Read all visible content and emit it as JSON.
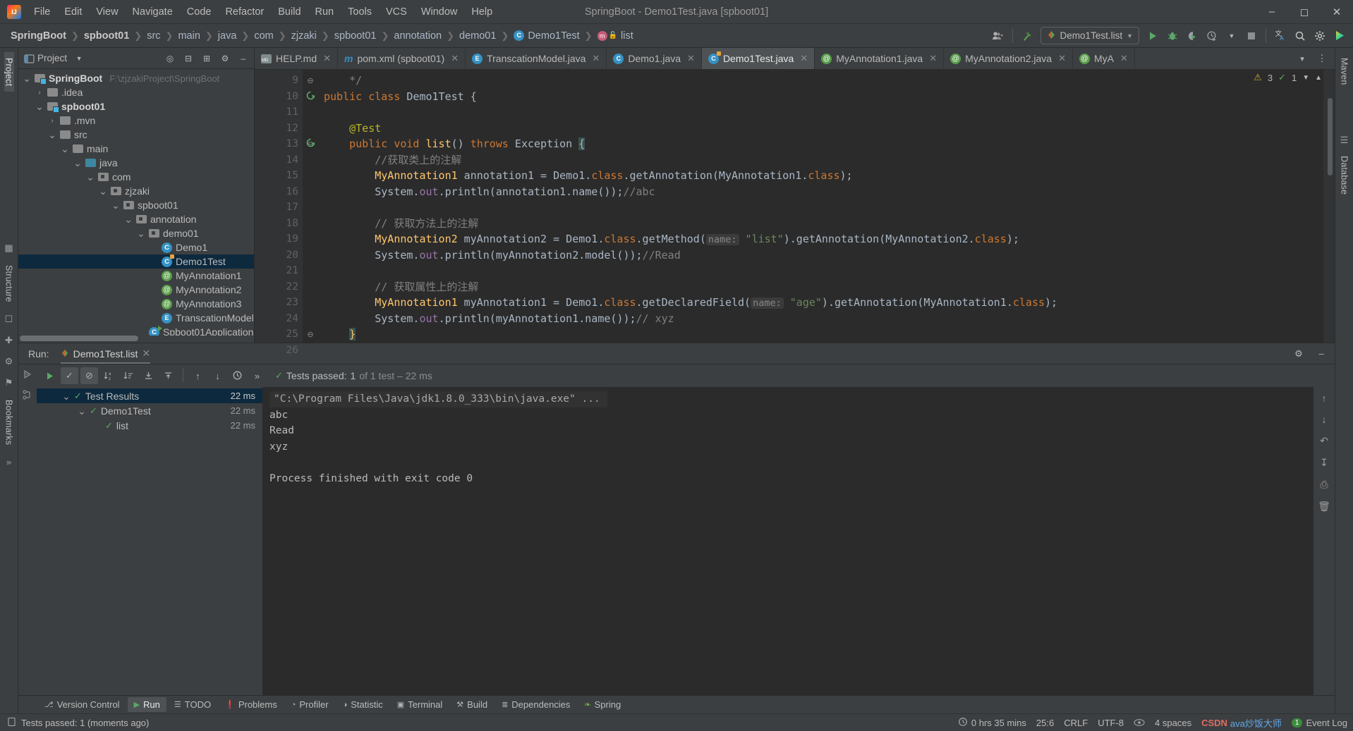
{
  "window": {
    "title": "SpringBoot - Demo1Test.java [spboot01]",
    "logo_icon": "intellij-idea-logo",
    "minimize_icon": "minimize-icon",
    "maximize_icon": "maximize-icon",
    "close_icon": "close-icon"
  },
  "menubar": {
    "items": [
      "File",
      "Edit",
      "View",
      "Navigate",
      "Code",
      "Refactor",
      "Build",
      "Run",
      "Tools",
      "VCS",
      "Window",
      "Help"
    ]
  },
  "navbar": {
    "crumbs": [
      {
        "label": "SpringBoot",
        "bold": true,
        "icon": ""
      },
      {
        "label": "spboot01",
        "bold": true,
        "icon": ""
      },
      {
        "label": "src",
        "bold": false,
        "icon": ""
      },
      {
        "label": "main",
        "bold": false,
        "icon": ""
      },
      {
        "label": "java",
        "bold": false,
        "icon": ""
      },
      {
        "label": "com",
        "bold": false,
        "icon": ""
      },
      {
        "label": "zjzaki",
        "bold": false,
        "icon": ""
      },
      {
        "label": "spboot01",
        "bold": false,
        "icon": ""
      },
      {
        "label": "annotation",
        "bold": false,
        "icon": ""
      },
      {
        "label": "demo01",
        "bold": false,
        "icon": ""
      },
      {
        "label": "Demo1Test",
        "bold": false,
        "icon": "class-icon"
      },
      {
        "label": "list",
        "bold": false,
        "icon": "method-icon"
      }
    ],
    "run_config": "Demo1Test.list",
    "run_config_icon": "junit-icon",
    "icons": [
      "user-icon",
      "hammer-build-icon",
      "run-icon",
      "debug-icon",
      "run-coverage-icon",
      "profile-icon",
      "stop-icon",
      "translate-icon",
      "search-icon",
      "settings-gear-icon",
      "idea-assistant-icon"
    ]
  },
  "project_panel": {
    "title": "Project",
    "header_icons": [
      "project-view-dropdown",
      "locate-file-icon",
      "expand-all-icon",
      "collapse-all-icon",
      "settings-gear-icon",
      "hide-icon"
    ],
    "tree": [
      {
        "label": "SpringBoot",
        "path": "F:\\zjzakiProject\\SpringBoot",
        "indent": 0,
        "chevron": "down",
        "icon": "module-folder-icon",
        "bold": true,
        "selected": false
      },
      {
        "label": ".idea",
        "path": "",
        "indent": 1,
        "chevron": "right",
        "icon": "folder-icon",
        "bold": false,
        "selected": false
      },
      {
        "label": "spboot01",
        "path": "",
        "indent": 1,
        "chevron": "down",
        "icon": "module-folder-icon",
        "bold": true,
        "selected": false
      },
      {
        "label": ".mvn",
        "path": "",
        "indent": 2,
        "chevron": "right",
        "icon": "folder-icon",
        "bold": false,
        "selected": false
      },
      {
        "label": "src",
        "path": "",
        "indent": 2,
        "chevron": "down",
        "icon": "folder-icon",
        "bold": false,
        "selected": false
      },
      {
        "label": "main",
        "path": "",
        "indent": 3,
        "chevron": "down",
        "icon": "folder-icon",
        "bold": false,
        "selected": false
      },
      {
        "label": "java",
        "path": "",
        "indent": 4,
        "chevron": "down",
        "icon": "source-folder-icon",
        "bold": false,
        "selected": false
      },
      {
        "label": "com",
        "path": "",
        "indent": 5,
        "chevron": "down",
        "icon": "package-icon",
        "bold": false,
        "selected": false
      },
      {
        "label": "zjzaki",
        "path": "",
        "indent": 6,
        "chevron": "down",
        "icon": "package-icon",
        "bold": false,
        "selected": false
      },
      {
        "label": "spboot01",
        "path": "",
        "indent": 7,
        "chevron": "down",
        "icon": "package-icon",
        "bold": false,
        "selected": false
      },
      {
        "label": "annotation",
        "path": "",
        "indent": 8,
        "chevron": "down",
        "icon": "package-icon",
        "bold": false,
        "selected": false
      },
      {
        "label": "demo01",
        "path": "",
        "indent": 9,
        "chevron": "down",
        "icon": "package-icon",
        "bold": false,
        "selected": false
      },
      {
        "label": "Demo1",
        "path": "",
        "indent": 10,
        "chevron": "",
        "icon": "class-icon",
        "bold": false,
        "selected": false
      },
      {
        "label": "Demo1Test",
        "path": "",
        "indent": 10,
        "chevron": "",
        "icon": "test-class-icon",
        "bold": false,
        "selected": true
      },
      {
        "label": "MyAnnotation1",
        "path": "",
        "indent": 10,
        "chevron": "",
        "icon": "annotation-icon",
        "bold": false,
        "selected": false
      },
      {
        "label": "MyAnnotation2",
        "path": "",
        "indent": 10,
        "chevron": "",
        "icon": "annotation-icon",
        "bold": false,
        "selected": false
      },
      {
        "label": "MyAnnotation3",
        "path": "",
        "indent": 10,
        "chevron": "",
        "icon": "annotation-icon",
        "bold": false,
        "selected": false
      },
      {
        "label": "TranscationModel",
        "path": "",
        "indent": 10,
        "chevron": "",
        "icon": "enum-icon",
        "bold": false,
        "selected": false
      },
      {
        "label": "Spboot01Application",
        "path": "",
        "indent": 9,
        "chevron": "",
        "icon": "runnable-class-icon",
        "bold": false,
        "selected": false
      }
    ]
  },
  "editor": {
    "tabs": [
      {
        "label": "HELP.md",
        "icon": "markdown-icon",
        "active": false
      },
      {
        "label": "pom.xml (spboot01)",
        "icon": "maven-icon",
        "active": false
      },
      {
        "label": "TranscationModel.java",
        "icon": "enum-icon",
        "active": false
      },
      {
        "label": "Demo1.java",
        "icon": "class-icon",
        "active": false
      },
      {
        "label": "Demo1Test.java",
        "icon": "test-class-icon",
        "active": true
      },
      {
        "label": "MyAnnotation1.java",
        "icon": "annotation-icon",
        "active": false
      },
      {
        "label": "MyAnnotation2.java",
        "icon": "annotation-icon",
        "active": false
      },
      {
        "label": "MyA",
        "icon": "annotation-icon",
        "active": false
      }
    ],
    "tabbar_icons": [
      "chevron-down-icon",
      "more-vertical-icon"
    ],
    "inspection": {
      "warnings": "3",
      "checks": "1",
      "warning_icon": "warning-triangle-icon",
      "check_icon": "check-icon"
    },
    "first_line_number": 9,
    "lines": [
      {
        "n": 9,
        "run_marker": false,
        "fold": "end",
        "html": "    <span class='cmt'>*/</span>"
      },
      {
        "n": 10,
        "run_marker": true,
        "fold": "",
        "html": "<span class='kw'>public class</span> <span class='mth'>Demo1Test</span> {"
      },
      {
        "n": 11,
        "run_marker": false,
        "fold": "",
        "html": ""
      },
      {
        "n": 12,
        "run_marker": false,
        "fold": "",
        "html": "    <span class='ann'>@Test</span>"
      },
      {
        "n": 13,
        "run_marker": true,
        "fold": "start",
        "html": "    <span class='kw'>public void</span> <span class='typ'>list</span>() <span class='kw'>throws</span> Exception <span class='brace-hl'>{</span>"
      },
      {
        "n": 14,
        "run_marker": false,
        "fold": "",
        "html": "        <span class='cmt'>//获取类上的注解</span>"
      },
      {
        "n": 15,
        "run_marker": false,
        "fold": "",
        "html": "        <span class='typ'>MyAnnotation1</span> annotation1 = Demo1.<span class='kw'>class</span>.getAnnotation(MyAnnotation1.<span class='kw'>class</span>);"
      },
      {
        "n": 16,
        "run_marker": false,
        "fold": "",
        "html": "        System.<span class='fld'>out</span>.println(annotation1.name());<span class='cmt'>//abc</span>"
      },
      {
        "n": 17,
        "run_marker": false,
        "fold": "",
        "html": ""
      },
      {
        "n": 18,
        "run_marker": false,
        "fold": "",
        "html": "        <span class='cmt'>// 获取方法上的注解</span>"
      },
      {
        "n": 19,
        "run_marker": false,
        "fold": "",
        "html": "        <span class='typ'>MyAnnotation2</span> myAnnotation2 = Demo1.<span class='kw'>class</span>.getMethod(<span class='hint'>name:</span> <span class='str'>\"list\"</span>).getAnnotation(MyAnnotation2.<span class='kw'>class</span>);"
      },
      {
        "n": 20,
        "run_marker": false,
        "fold": "",
        "html": "        System.<span class='fld'>out</span>.println(myAnnotation2.model());<span class='cmt'>//Read</span>"
      },
      {
        "n": 21,
        "run_marker": false,
        "fold": "",
        "html": ""
      },
      {
        "n": 22,
        "run_marker": false,
        "fold": "",
        "html": "        <span class='cmt'>// 获取属性上的注解</span>"
      },
      {
        "n": 23,
        "run_marker": false,
        "fold": "",
        "html": "        <span class='typ'>MyAnnotation1</span> myAnnotation1 = Demo1.<span class='kw'>class</span>.getDeclaredField(<span class='hint'>name:</span> <span class='str'>\"age\"</span>).getAnnotation(MyAnnotation1.<span class='kw'>class</span>);"
      },
      {
        "n": 24,
        "run_marker": false,
        "fold": "",
        "html": "        System.<span class='fld'>out</span>.println(myAnnotation1.name());<span class='cmt'>// xyz</span>"
      },
      {
        "n": 25,
        "run_marker": false,
        "fold": "end",
        "html": "    <span class='brace-hl' style='color:#ffc66d'>}</span>"
      },
      {
        "n": 26,
        "run_marker": false,
        "fold": "",
        "html": ""
      }
    ]
  },
  "run_panel": {
    "label": "Run:",
    "tab_label": "Demo1Test.list",
    "tab_icon": "junit-run-icon",
    "header_icons": [
      "settings-gear-icon",
      "hide-icon"
    ],
    "toolbar_icons": [
      "rerun-icon",
      "show-passed-icon",
      "hide-ignored-icon",
      "sort-alphabetically-icon",
      "sort-by-duration-icon",
      "expand-all-icon",
      "collapse-all-icon",
      "prev-failed-icon",
      "next-failed-icon",
      "test-history-icon",
      "more-icon"
    ],
    "status_prefix": "Tests passed:",
    "status_count": "1",
    "status_suffix": "of 1 test – 22 ms",
    "side_icons": [
      "rerun-failed-icon",
      "toggle-auto-test-icon"
    ],
    "tree": [
      {
        "label": "Test Results",
        "ms": "22 ms",
        "indent": 0,
        "chevron": "down",
        "selected": true
      },
      {
        "label": "Demo1Test",
        "ms": "22 ms",
        "indent": 1,
        "chevron": "down",
        "selected": false
      },
      {
        "label": "list",
        "ms": "22 ms",
        "indent": 2,
        "chevron": "",
        "selected": false
      }
    ],
    "console": [
      {
        "text": "\"C:\\Program Files\\Java\\jdk1.8.0_333\\bin\\java.exe\" ...",
        "cmd": true
      },
      {
        "text": "abc",
        "cmd": false
      },
      {
        "text": "Read",
        "cmd": false
      },
      {
        "text": "xyz",
        "cmd": false
      },
      {
        "text": "",
        "cmd": false
      },
      {
        "text": "Process finished with exit code 0",
        "cmd": false
      }
    ],
    "console_rail_icons": [
      "scroll-up-icon",
      "scroll-down-icon",
      "soft-wrap-icon",
      "scroll-to-end-icon",
      "print-icon",
      "clear-all-icon"
    ]
  },
  "toolwindow_bar": {
    "items": [
      {
        "label": "Version Control",
        "icon": "vcs-branch-icon",
        "active": false
      },
      {
        "label": "Run",
        "icon": "run-icon",
        "active": true
      },
      {
        "label": "TODO",
        "icon": "todo-list-icon",
        "active": false
      },
      {
        "label": "Problems",
        "icon": "problems-icon",
        "active": false
      },
      {
        "label": "Profiler",
        "icon": "profiler-icon",
        "active": false
      },
      {
        "label": "Statistic",
        "icon": "statistic-icon",
        "active": false
      },
      {
        "label": "Terminal",
        "icon": "terminal-icon",
        "active": false
      },
      {
        "label": "Build",
        "icon": "hammer-build-icon",
        "active": false
      },
      {
        "label": "Dependencies",
        "icon": "dependencies-icon",
        "active": false
      },
      {
        "label": "Spring",
        "icon": "spring-leaf-icon",
        "active": false
      }
    ]
  },
  "left_rail": {
    "items": [
      {
        "label": "Project",
        "selected": true,
        "icon": "project-icon"
      },
      {
        "label": "Structure",
        "selected": false,
        "icon": "structure-icon"
      },
      {
        "label": "Bookmarks",
        "selected": false,
        "icon": "bookmarks-icon"
      }
    ]
  },
  "right_rail": {
    "items": [
      {
        "label": "Maven",
        "icon": "maven-icon"
      },
      {
        "label": "Database",
        "icon": "database-icon"
      }
    ]
  },
  "statusbar": {
    "message": "Tests passed: 1 (moments ago)",
    "message_icon": "tests-passed-icon",
    "timer_icon": "clock-icon",
    "timer": "0 hrs 35 mins",
    "caret": "25:6",
    "line_separator": "CRLF",
    "encoding": "UTF-8",
    "read_only_icon": "eye-icon",
    "indent": "4 spaces",
    "event_log": "Event Log",
    "event_count": "1",
    "watermark_csdn": "CSDN",
    "watermark_author": "ava炒饭大师"
  }
}
